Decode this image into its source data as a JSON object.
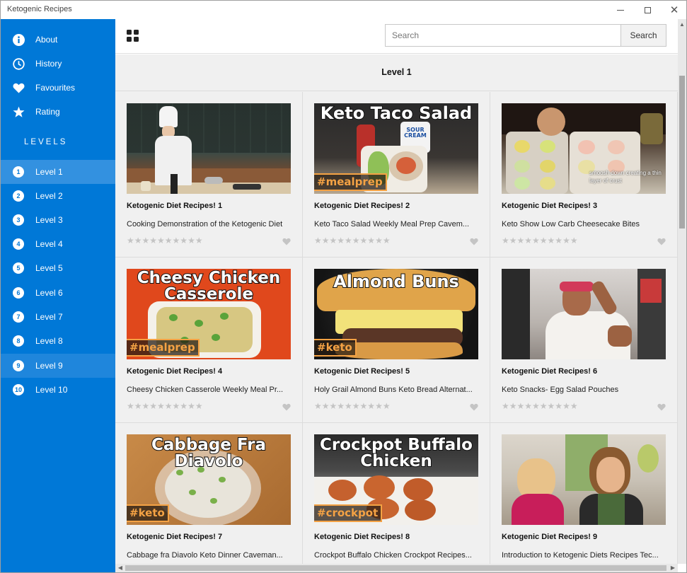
{
  "app": {
    "title": "Ketogenic Recipes"
  },
  "sidebar": {
    "nav": [
      {
        "label": "About",
        "icon": "info-icon"
      },
      {
        "label": "History",
        "icon": "clock-icon"
      },
      {
        "label": "Favourites",
        "icon": "heart-icon"
      },
      {
        "label": "Rating",
        "icon": "star-icon"
      }
    ],
    "levels_header": "LEVELS",
    "levels": [
      {
        "num": "1",
        "label": "Level 1"
      },
      {
        "num": "2",
        "label": "Level 2"
      },
      {
        "num": "3",
        "label": "Level 3"
      },
      {
        "num": "4",
        "label": "Level 4"
      },
      {
        "num": "5",
        "label": "Level 5"
      },
      {
        "num": "6",
        "label": "Level 6"
      },
      {
        "num": "7",
        "label": "Level 7"
      },
      {
        "num": "8",
        "label": "Level 8"
      },
      {
        "num": "9",
        "label": "Level 9"
      },
      {
        "num": "10",
        "label": "Level 10"
      }
    ],
    "selected_level": "Level 1",
    "highlighted_level": "Level 9"
  },
  "toolbar": {
    "search_placeholder": "Search",
    "search_button": "Search"
  },
  "main": {
    "title": "Level 1",
    "cards": [
      {
        "title": "Ketogenic Diet Recipes! 1",
        "desc": "Cooking Demonstration of the Ketogenic Diet",
        "overlay": "",
        "tag": ""
      },
      {
        "title": "Ketogenic Diet Recipes! 2",
        "desc": "Keto Taco Salad Weekly Meal Prep Cavem...",
        "overlay": "Keto Taco Salad",
        "tag": "#mealprep",
        "sign": "SOUR CREAM"
      },
      {
        "title": "Ketogenic Diet Recipes! 3",
        "desc": "Keto Show Low Carb Cheesecake Bites",
        "overlay": "",
        "tag": "",
        "caption": "smoosh down creating a thin layer of crust"
      },
      {
        "title": "Ketogenic Diet Recipes! 4",
        "desc": "Cheesy Chicken Casserole Weekly Meal Pr...",
        "overlay": "Cheesy Chicken Casserole",
        "tag": "#mealprep"
      },
      {
        "title": "Ketogenic Diet Recipes! 5",
        "desc": "Holy Grail Almond Buns Keto Bread Alternat...",
        "overlay": "Almond Buns",
        "tag": "#keto"
      },
      {
        "title": "Ketogenic Diet Recipes! 6",
        "desc": "Keto Snacks- Egg Salad Pouches",
        "overlay": "",
        "tag": ""
      },
      {
        "title": "Ketogenic Diet Recipes! 7",
        "desc": "Cabbage fra Diavolo Keto Dinner Caveman...",
        "overlay": "Cabbage Fra Diavolo",
        "tag": "#keto"
      },
      {
        "title": "Ketogenic Diet Recipes! 8",
        "desc": "Crockpot Buffalo Chicken Crockpot Recipes...",
        "overlay": "Crockpot Buffalo Chicken",
        "tag": "#crockpot"
      },
      {
        "title": "Ketogenic Diet Recipes! 9",
        "desc": "Introduction to Ketogenic Diets Recipes Tec...",
        "overlay": "",
        "tag": ""
      }
    ],
    "rating_stars": "★★★★★★★★★★"
  },
  "colors": {
    "sidebar_bg": "#0078d7",
    "sidebar_active": "#3391e0",
    "content_bg": "#f0f0f0",
    "tag_color": "#f4a244"
  }
}
